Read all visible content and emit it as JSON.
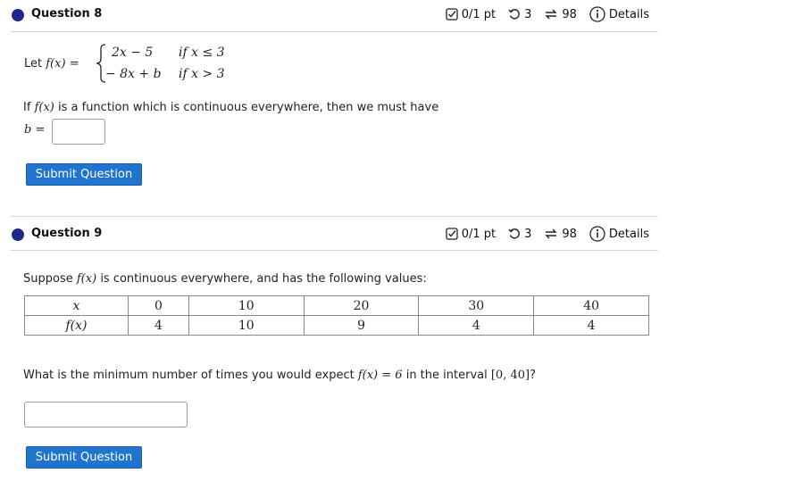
{
  "q8": {
    "title": "Question 8",
    "meta": {
      "score": "0/1 pt",
      "retries": "3",
      "attempts": "98",
      "details": "Details"
    },
    "let_label": "Let",
    "func": "f(x)",
    "eq": "=",
    "case1_expr": "2x − 5",
    "case1_cond": "if  x ≤ 3",
    "case2_expr": "− 8x + b",
    "case2_cond": "if  x > 3",
    "prompt_pre": "If",
    "prompt_func": "f(x)",
    "prompt_post": "is a function which is continuous everywhere, then we must have",
    "answer_var": "b",
    "answer_eq": "=",
    "answer_value": "",
    "submit": "Submit Question"
  },
  "q9": {
    "title": "Question 9",
    "meta": {
      "score": "0/1 pt",
      "retries": "3",
      "attempts": "98",
      "details": "Details"
    },
    "intro_pre": "Suppose",
    "intro_func": "f(x)",
    "intro_post": "is continuous everywhere, and has the following values:",
    "table": {
      "row_headers": [
        "x",
        "f(x)"
      ],
      "x": [
        "0",
        "10",
        "20",
        "30",
        "40"
      ],
      "fx": [
        "4",
        "10",
        "9",
        "4",
        "4"
      ]
    },
    "question_pre": "What is the minimum number of times you would expect",
    "question_eq": "f(x) = 6",
    "question_mid": "in the interval",
    "question_interval": "[0, 40]",
    "question_end": "?",
    "answer_value": "",
    "submit": "Submit Question"
  },
  "colors": {
    "accent": "#1f74cf",
    "dot": "#1d2a8c"
  },
  "icons": [
    "checkbox-score-icon",
    "retry-icon",
    "attempts-icon",
    "info-icon"
  ]
}
